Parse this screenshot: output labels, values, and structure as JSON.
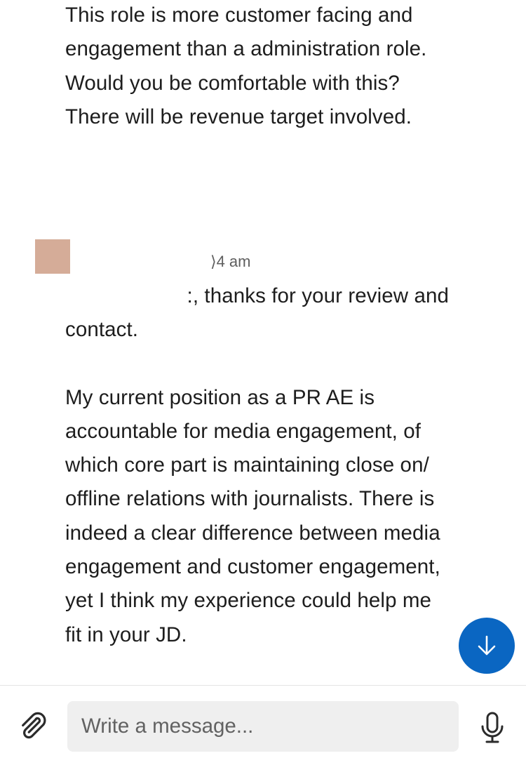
{
  "thread": {
    "previous_message": {
      "text": "This role is more customer facing and\nengagement than a administration role.\nWould you be comfortable with this?\nThere will be revenue target involved."
    },
    "reply": {
      "timestamp": "⟩4 am",
      "first_line": ":, thanks for your review and",
      "body": "contact.\n\nMy current position as a PR AE is\naccountable for media engagement, of\nwhich core part is maintaining close on/\noffline relations with journalists. There is\nindeed a clear difference between media\nengagement and customer engagement,\nyet I think my experience could help me\nfit in your JD."
    }
  },
  "scroll_button": {
    "icon": "arrow-down-icon",
    "color": "#0a66c2"
  },
  "composer": {
    "attach_icon": "paperclip-icon",
    "placeholder": "Write a message...",
    "value": "",
    "mic_icon": "microphone-icon"
  },
  "colors": {
    "avatar": "#d5ac98",
    "text": "#1d1d1d",
    "muted": "#5e5e5e",
    "input_bg": "#efefef"
  }
}
